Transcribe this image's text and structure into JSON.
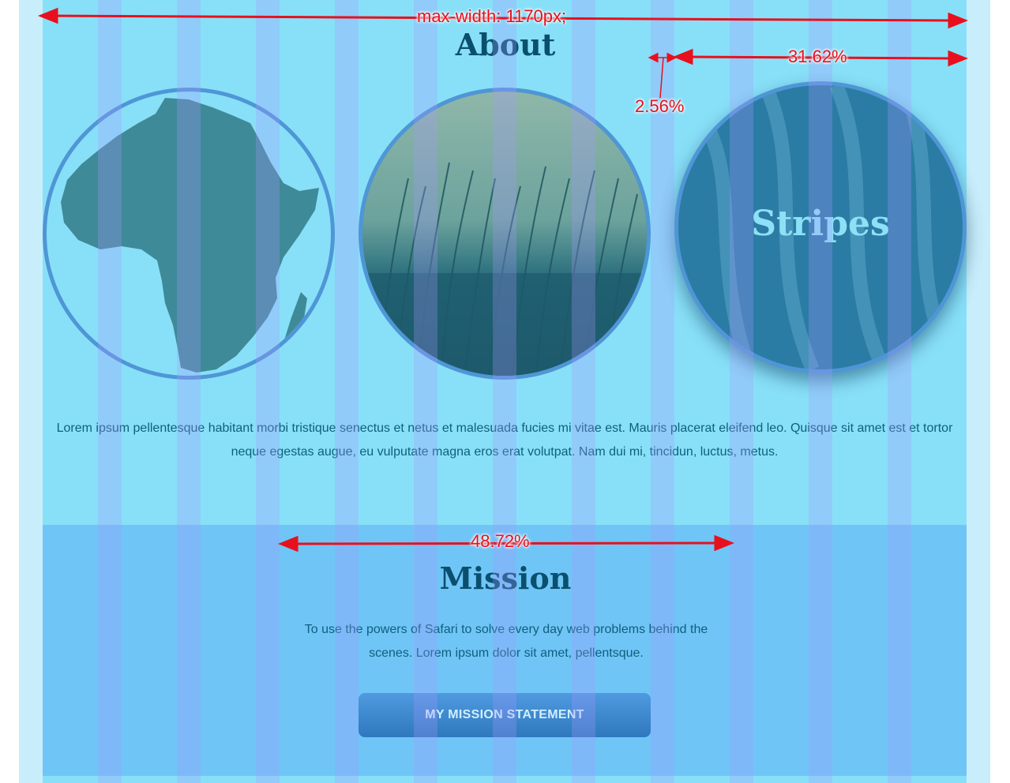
{
  "annotations": {
    "max_width": "max-width: 1170px;",
    "col_third": "31.62%",
    "gutter": "2.56%",
    "half": "48.72%"
  },
  "about": {
    "title": "About",
    "images": [
      {
        "kind": "africa-map",
        "label": ""
      },
      {
        "kind": "grass-photo",
        "label": ""
      },
      {
        "kind": "zebra-stripes",
        "label": "Stripes"
      }
    ],
    "text": "Lorem ipsum pellentesque habitant morbi tristique senectus et netus et malesuada fucies mi vitae est. Mauris placerat eleifend leo. Quisque sit amet est et tortor neque egestas augue, eu vulputate magna eros erat volutpat. Nam dui mi, tincidun, luctus, metus."
  },
  "mission": {
    "title": "Mission",
    "text": "To use the powers of Safari to solve every day web problems behind the scenes. Lorem ipsum dolor sit amet, pellentsque.",
    "button_label": "MY MISSION STATEMENT"
  },
  "colors": {
    "page_bg": "#c8eefb",
    "content_bg": "#88e0f8",
    "mission_bg": "#6fc5f6",
    "heading": "#0a4f6e",
    "annotation": "#e8101c",
    "button": "#3a86cf"
  }
}
